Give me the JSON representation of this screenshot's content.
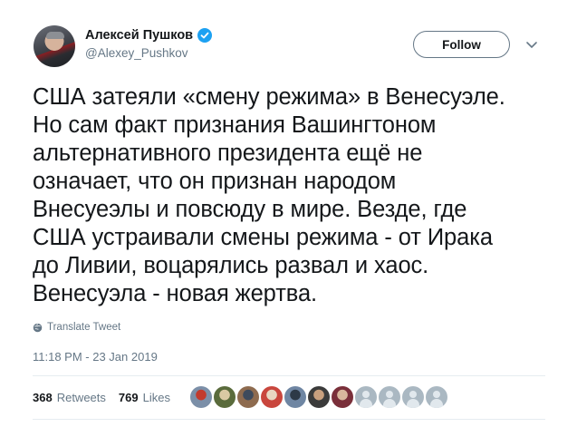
{
  "author": {
    "name": "Алексей Пушков",
    "handle": "@Alexey_Pushkov",
    "verified": true
  },
  "follow_button": {
    "label": "Follow"
  },
  "tweet": {
    "lines": [
      "США затеяли «смену режима» в Венесуэле.",
      "Но сам факт признания Вашингтоном",
      "альтернативного президента ещё не",
      "означает, что он признан народом",
      "Внесуеэлы и повсюду в мире. Везде, где",
      "США устраивали смены режима - от Ирака",
      "до Ливии, воцарялись развал и хаос.",
      "Венесуэла - новая жертва."
    ]
  },
  "translate": {
    "label": "Translate Tweet",
    "icon": "globe-icon"
  },
  "timestamp": "11:18 PM - 23 Jan 2019",
  "stats": {
    "retweets_count": "368",
    "retweets_label": "Retweets",
    "likes_count": "769",
    "likes_label": "Likes"
  },
  "likers": [
    {
      "color": "#7b8fa8",
      "accent": "#c23b2e"
    },
    {
      "color": "#5a6b3c",
      "accent": "#d9c9a3"
    },
    {
      "color": "#8e6b4f",
      "accent": "#3d4a5c"
    },
    {
      "color": "#c9463d",
      "accent": "#e8d7c2"
    },
    {
      "color": "#6f86a3",
      "accent": "#2d3947"
    },
    {
      "color": "#3b3b3b",
      "accent": "#c9a07e"
    },
    {
      "color": "#7a2f3a",
      "accent": "#d8b79c"
    }
  ],
  "likers_placeholders": 4,
  "colors": {
    "text": "#14171a",
    "secondary": "#657786",
    "verified": "#1da1f2",
    "divider": "#e6ecf0"
  }
}
